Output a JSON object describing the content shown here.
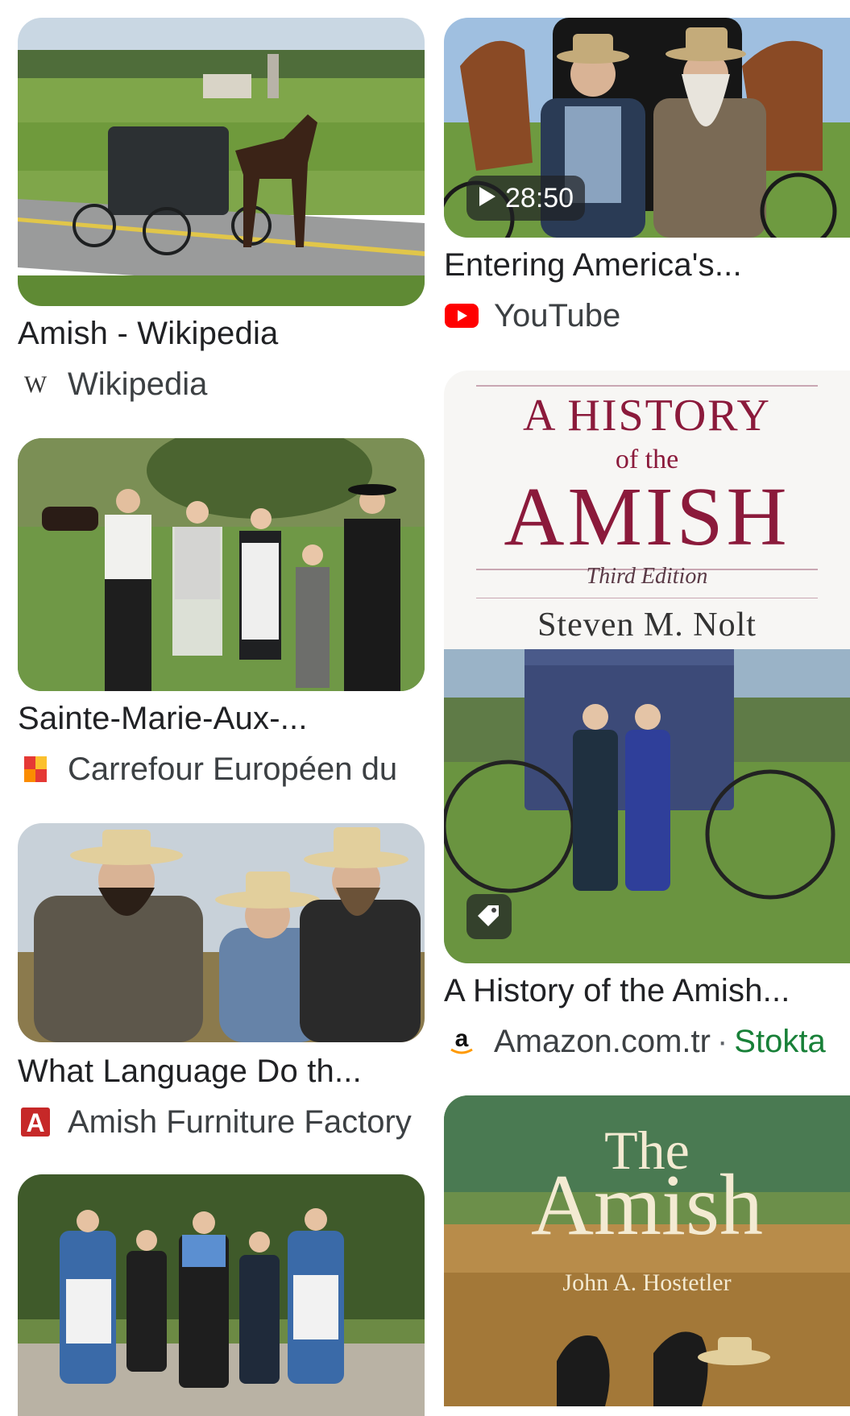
{
  "results": [
    {
      "title": "Amish - Wikipedia",
      "source": "Wikipedia",
      "favicon": "wikipedia-w-icon"
    },
    {
      "title": "Sainte-Marie-Aux-...",
      "source": "Carrefour Européen du",
      "favicon": "carrefour-europeen-icon"
    },
    {
      "title": "What Language Do th...",
      "source": "Amish Furniture Factory",
      "favicon": "amish-furniture-factory-icon"
    },
    {
      "title": "Entering America's...",
      "source": "YouTube",
      "favicon": "youtube-icon",
      "duration": "28:50"
    },
    {
      "title": "A History of the Amish...",
      "source": "Amazon.com.tr",
      "stock": "Stokta",
      "favicon": "amazon-icon"
    },
    {
      "title": "",
      "source": ""
    }
  ],
  "book1": {
    "line1": "A HISTORY",
    "line2": "of the",
    "line3": "AMISH",
    "edition": "Third Edition",
    "author": "Steven M. Nolt"
  },
  "book2": {
    "line1": "The",
    "line2": "Amish",
    "author": "John A. Hostetler"
  },
  "colors": {
    "text": "#202124",
    "stock": "#188038",
    "youtube": "#ff0000",
    "book_title": "#8b1a3b"
  }
}
